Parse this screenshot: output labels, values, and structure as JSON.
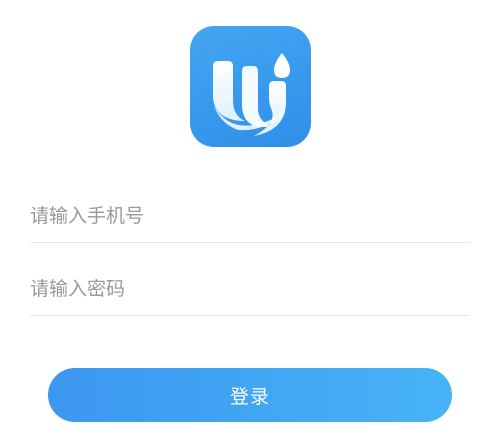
{
  "app": {
    "logo_icon": "wi-droplet-logo-icon",
    "accent_color": "#3a9cf1"
  },
  "login_form": {
    "phone_placeholder": "请输入手机号",
    "phone_value": "",
    "password_placeholder": "请输入密码",
    "password_value": "",
    "submit_label": "登录"
  }
}
